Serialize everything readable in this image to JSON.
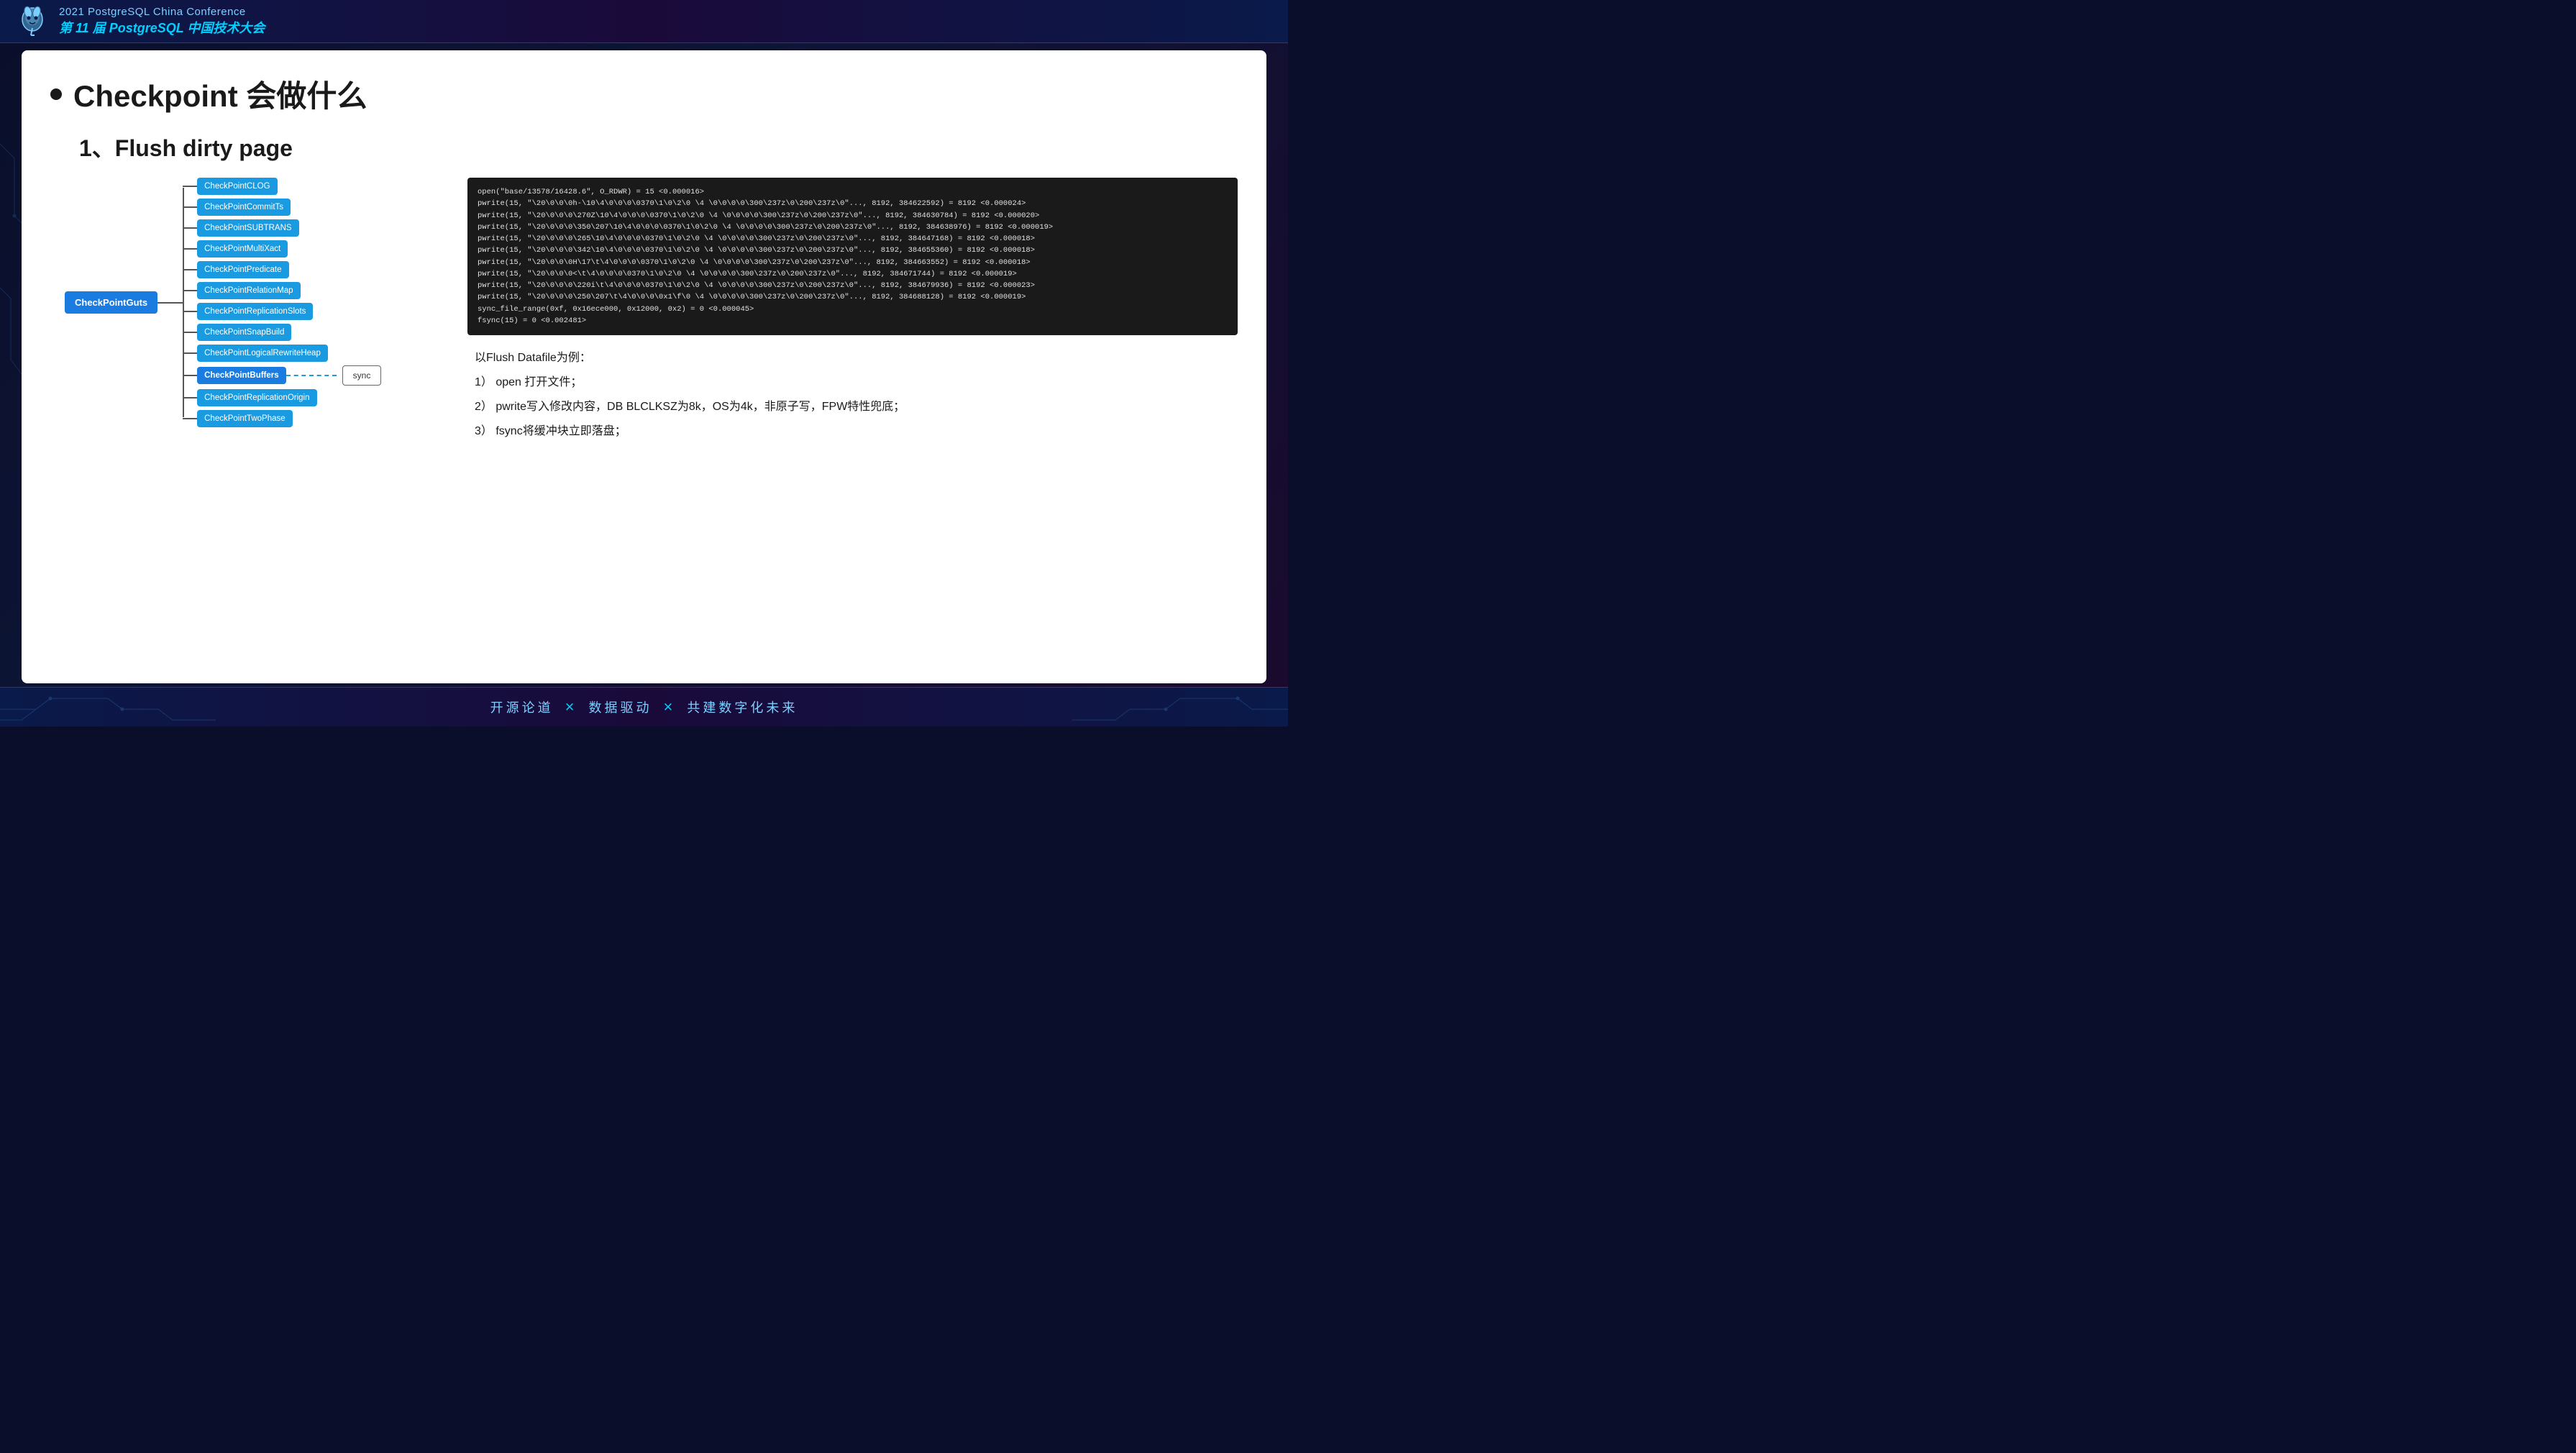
{
  "header": {
    "title_en": "2021 PostgreSQL China Conference",
    "title_cn": "第 11 届 PostgreSQL 中国技术大会"
  },
  "slide": {
    "title": "Checkpoint 会做什么",
    "section": "1、Flush dirty page",
    "flowchart": {
      "main_node": "CheckPointGuts",
      "branches": [
        "CheckPointCLOG",
        "CheckPointCommitTs",
        "CheckPointSUBTRANS",
        "CheckPointMultiXact",
        "CheckPointPredicate",
        "CheckPointRelationMap",
        "CheckPointReplicationSlots",
        "CheckPointSnapBuild",
        "CheckPointLogicalRewriteHeap",
        "CheckPointBuffers",
        "CheckPointReplicationOrigin",
        "CheckPointTwoPhase"
      ],
      "sync_node": "sync",
      "highlighted_branch": "CheckPointBuffers"
    },
    "code_lines": [
      "open(\"base/13578/16428.6\", O_RDWR) = 15 <0.000016>",
      "pwrite(15, \"\\20\\0\\0\\0h-\\10\\4\\0\\0\\0\\0370\\1\\0\\2\\0 \\4 \\0\\0\\0\\0\\300\\237z\\0\\200\\237z\\0\"..., 8192, 384622592) = 8192 <0.000024>",
      "pwrite(15, \"\\20\\0\\0\\0\\270Z\\10\\4\\0\\0\\0\\0370\\1\\0\\2\\0 \\4 \\0\\0\\0\\0\\300\\237z\\0\\200\\237z\\0\"..., 8192, 384630784) = 8192 <0.000020>",
      "pwrite(15, \"\\20\\0\\0\\0\\350\\207\\10\\4\\0\\0\\0\\0370\\1\\0\\2\\0 \\4 \\0\\0\\0\\0\\300\\237z\\0\\200\\237z\\0\"..., 8192, 384638976) = 8192 <0.000019>",
      "pwrite(15, \"\\20\\0\\0\\0\\265\\10\\4\\0\\0\\0\\0370\\1\\0\\2\\0 \\4 \\0\\0\\0\\0\\300\\237z\\0\\200\\237z\\0\"..., 8192, 384647168) = 8192 <0.000018>",
      "pwrite(15, \"\\20\\0\\0\\0\\342\\10\\4\\0\\0\\0\\0370\\1\\0\\2\\0 \\4 \\0\\0\\0\\0\\300\\237z\\0\\200\\237z\\0\"..., 8192, 384655360) = 8192 <0.000018>",
      "pwrite(15, \"\\20\\0\\0\\0H\\17\\t\\4\\0\\0\\0\\0370\\1\\0\\2\\0 \\4 \\0\\0\\0\\0\\300\\237z\\0\\200\\237z\\0\"..., 8192, 384663552) = 8192 <0.000018>",
      "pwrite(15, \"\\20\\0\\0\\0^<\\t\\4\\0\\0\\0\\0370\\1\\0\\2\\0 \\4 \\0\\0\\0\\0\\300\\237z\\0\\200\\237z\\0\"..., 8192, 384671744) = 8192 <0.000019>",
      "pwrite(15, \"\\20\\0\\0\\0\\220i\\t\\4\\0\\0\\0\\0370\\1\\0\\2\\0 \\4 \\0\\0\\0\\0\\300\\237z\\0\\200\\237z\\0\"..., 8192, 384679936) = 8192 <0.000023>",
      "pwrite(15, \"\\20\\0\\0\\0\\250\\207\\t\\4\\0\\0\\0\\0x1\\f\\0 \\4 \\0\\0\\0\\0\\300\\237z\\0\\200\\237z\\0\"..., 8192, 384688128) = 8192 <0.000019>",
      "sync_file_range(0xf, 0x16ece000, 0x12000, 0x2) = 0 <0.000045>",
      "fsync(15)                                  = 0 <0.002481>"
    ],
    "description": {
      "intro": "以Flush Datafile为例：",
      "items": [
        "1）  open 打开文件；",
        "2）  pwrite写入修改内容，DB BLCLKSZ为8k，OS为4k，非原子写，FPW特性兜底；",
        "3）  fsync将缓冲块立即落盘；"
      ]
    }
  },
  "footer": {
    "text1": "开源论道",
    "divider1": "×",
    "text2": "数据驱动",
    "divider2": "×",
    "text3": "共建数字化未来"
  }
}
